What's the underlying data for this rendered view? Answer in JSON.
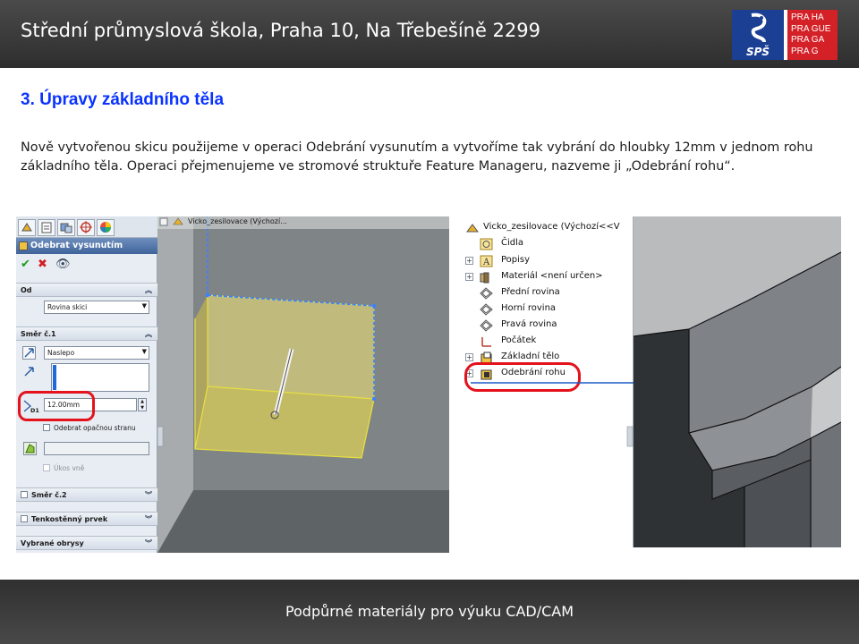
{
  "header": {
    "title": "Střední průmyslová škola, Praha 10, Na Třebešíně 2299",
    "logo": {
      "mark_text": "SPŠ",
      "lines": [
        "PRA HA",
        "PRA GUE",
        "PRA GA",
        "PRA G"
      ]
    }
  },
  "slide": {
    "title": "3. Úpravy základního těla",
    "paragraph": "Nově vytvořenou skicu použijeme v operaci Odebrání vysunutím a vytvoříme tak  vybrání do hloubky 12mm v jednom rohu základního těla. Operaci přejmenujeme ve stromové struktuře Feature Manageru, nazveme ji „Odebrání rohu“."
  },
  "property_manager": {
    "title": "Odebrat vysunutím",
    "group_from": "Od",
    "from_value": "Rovina skici",
    "group_direction1": "Směr č.1",
    "end_condition": "Naslepo",
    "depth_label": "D1",
    "depth_value": "12.00mm",
    "flip_side": "Odebrat opačnou stranu",
    "draft_outward": "Úkos vně",
    "group_direction2": "Směr č.2",
    "group_thin": "Tenkostěnný prvek",
    "group_contours": "Vybrané obrysy"
  },
  "viewport1": {
    "tree_root": "Vicko_zesilovace  (Výchozí..."
  },
  "feature_tree": {
    "root": "Vicko_zesilovace  (Výchozí<<V",
    "items": [
      {
        "label": "Čidla",
        "icon": "sensor-icon",
        "expandable": false
      },
      {
        "label": "Popisy",
        "icon": "annotation-icon",
        "expandable": true
      },
      {
        "label": "Materiál <není určen>",
        "icon": "material-icon",
        "expandable": true
      },
      {
        "label": "Přední rovina",
        "icon": "plane-icon",
        "expandable": false
      },
      {
        "label": "Horní rovina",
        "icon": "plane-icon",
        "expandable": false
      },
      {
        "label": "Pravá rovina",
        "icon": "plane-icon",
        "expandable": false
      },
      {
        "label": "Počátek",
        "icon": "origin-icon",
        "expandable": false
      },
      {
        "label": "Základní tělo",
        "icon": "extrude-icon",
        "expandable": true
      },
      {
        "label": "Odebrání rohu",
        "icon": "cut-extrude-icon",
        "expandable": true
      }
    ]
  },
  "footer": {
    "text": "Podpůrné materiály pro výuku CAD/CAM"
  },
  "colors": {
    "title_blue": "#0a33ff",
    "highlight_red": "#e3121b",
    "header_dark": "#3a3a3a",
    "logo_blue": "#1a3f93",
    "logo_red": "#d42027"
  }
}
